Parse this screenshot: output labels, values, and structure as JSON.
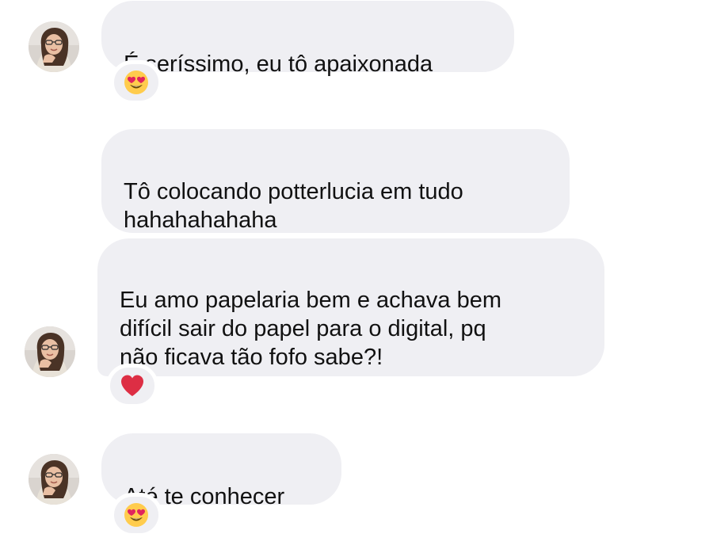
{
  "colors": {
    "bubble_background": "#efeff3",
    "text": "#111111",
    "page_background": "#ffffff"
  },
  "messages": [
    {
      "text": "É seríssimo, eu tô apaixonada",
      "reaction": "heart-eyes-emoji-icon",
      "has_avatar": true
    },
    {
      "text": "Tô colocando potterlucia em tudo\nhahahahahaha",
      "reaction": null,
      "has_avatar": false
    },
    {
      "text": "Eu amo papelaria bem e achava bem\ndifícil sair do papel para o digital, pq\nnão ficava tão fofo sabe?!",
      "reaction": "red-heart-emoji-icon",
      "has_avatar": true
    },
    {
      "text": "Até te conhecer",
      "reaction": "heart-eyes-emoji-icon",
      "has_avatar": true
    }
  ]
}
